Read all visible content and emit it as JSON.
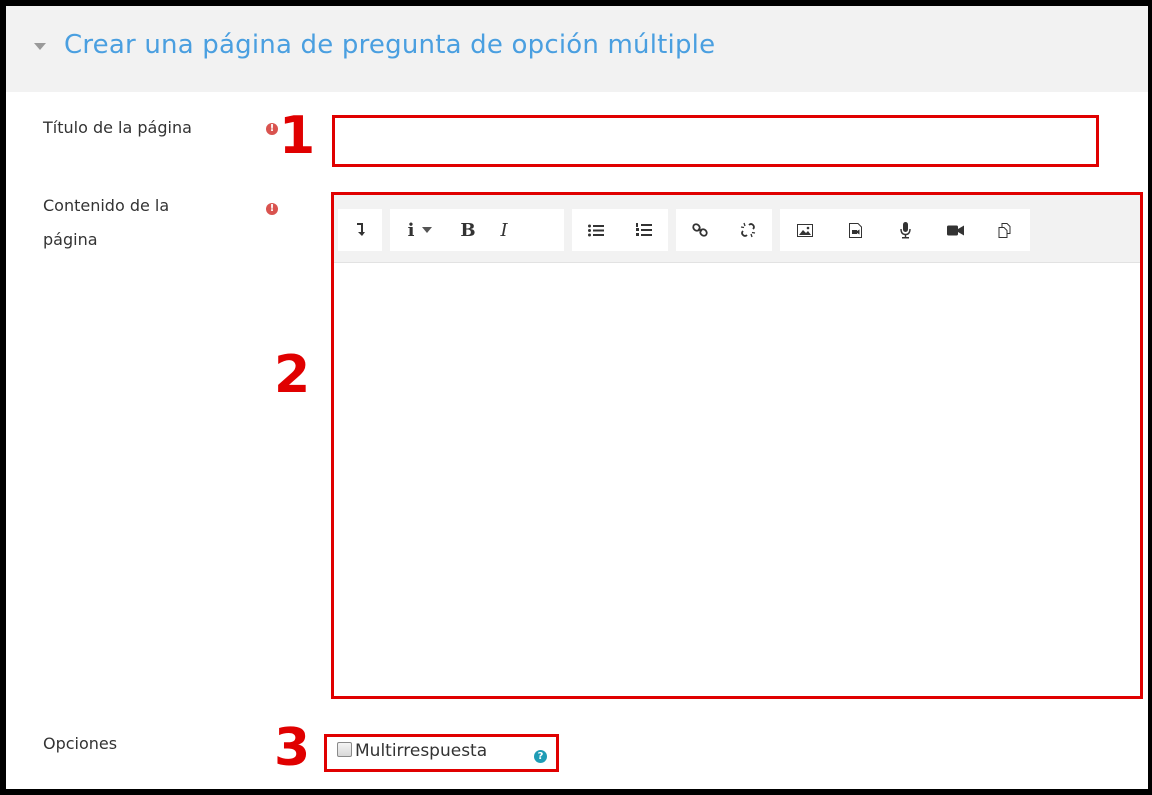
{
  "section": {
    "title": "Crear una página de pregunta de opción múltiple"
  },
  "fields": {
    "page_title": {
      "label": "Título de la página",
      "value": "",
      "required_icon": "exclamation-circle-icon"
    },
    "page_content": {
      "label_line1": "Contenido de la",
      "label_line2": "página",
      "required_icon": "exclamation-circle-icon",
      "value": ""
    },
    "options": {
      "label": "Opciones",
      "checkbox_label": "Multirrespuesta",
      "checked": false,
      "help_icon": "question-circle-icon"
    }
  },
  "annotations": {
    "one": "1",
    "two": "2",
    "three": "3",
    "color": "#e00000"
  },
  "toolbar": {
    "buttons": [
      {
        "name": "show-more-icon",
        "label": "↴"
      },
      {
        "name": "paragraph-style-icon",
        "label": "i"
      },
      {
        "name": "bold-icon",
        "label": "B"
      },
      {
        "name": "italic-icon",
        "label": "I"
      },
      {
        "name": "unordered-list-icon",
        "label": ""
      },
      {
        "name": "ordered-list-icon",
        "label": ""
      },
      {
        "name": "link-icon",
        "label": ""
      },
      {
        "name": "unlink-icon",
        "label": ""
      },
      {
        "name": "image-icon",
        "label": ""
      },
      {
        "name": "media-icon",
        "label": ""
      },
      {
        "name": "record-audio-icon",
        "label": ""
      },
      {
        "name": "record-video-icon",
        "label": ""
      },
      {
        "name": "manage-files-icon",
        "label": ""
      }
    ]
  },
  "colors": {
    "accent": "#4a9fe0",
    "required": "#d9534f",
    "help": "#1f9cb5"
  }
}
